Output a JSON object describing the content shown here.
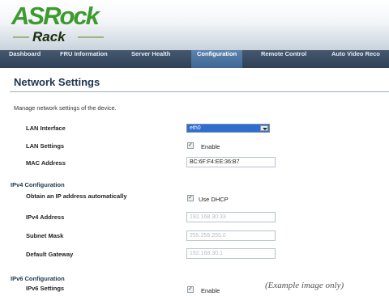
{
  "brand": {
    "logo_top": "ASRock",
    "logo_bottom": "Rack"
  },
  "nav": [
    {
      "label": "Dashboard",
      "active": false
    },
    {
      "label": "FRU Information",
      "active": false
    },
    {
      "label": "Server Health",
      "active": false
    },
    {
      "label": "Configuration",
      "active": true
    },
    {
      "label": "Remote Control",
      "active": false
    },
    {
      "label": "Auto Video Reco",
      "active": false
    }
  ],
  "page": {
    "title": "Network Settings",
    "description": "Manage network settings of the device."
  },
  "lan": {
    "interface_label": "LAN Interface",
    "interface_value": "eth0",
    "settings_label": "LAN Settings",
    "enable_label": "Enable",
    "mac_label": "MAC Address",
    "mac_value": "BC:6F:F4:EE:36:B7"
  },
  "ipv4": {
    "section": "IPv4 Configuration",
    "auto_label": "Obtain an IP address automatically",
    "dhcp_label": "Use DHCP",
    "address_label": "IPv4 Address",
    "address_value": "192.168.30.33",
    "mask_label": "Subnet Mask",
    "mask_value": "255.255.255.0",
    "gateway_label": "Default Gateway",
    "gateway_value": "192.168.30.1"
  },
  "ipv6": {
    "section": "IPv6 Configuration",
    "settings_label": "IPv6 Settings",
    "enable_label": "Enable"
  },
  "footnote": "(Example image only)"
}
